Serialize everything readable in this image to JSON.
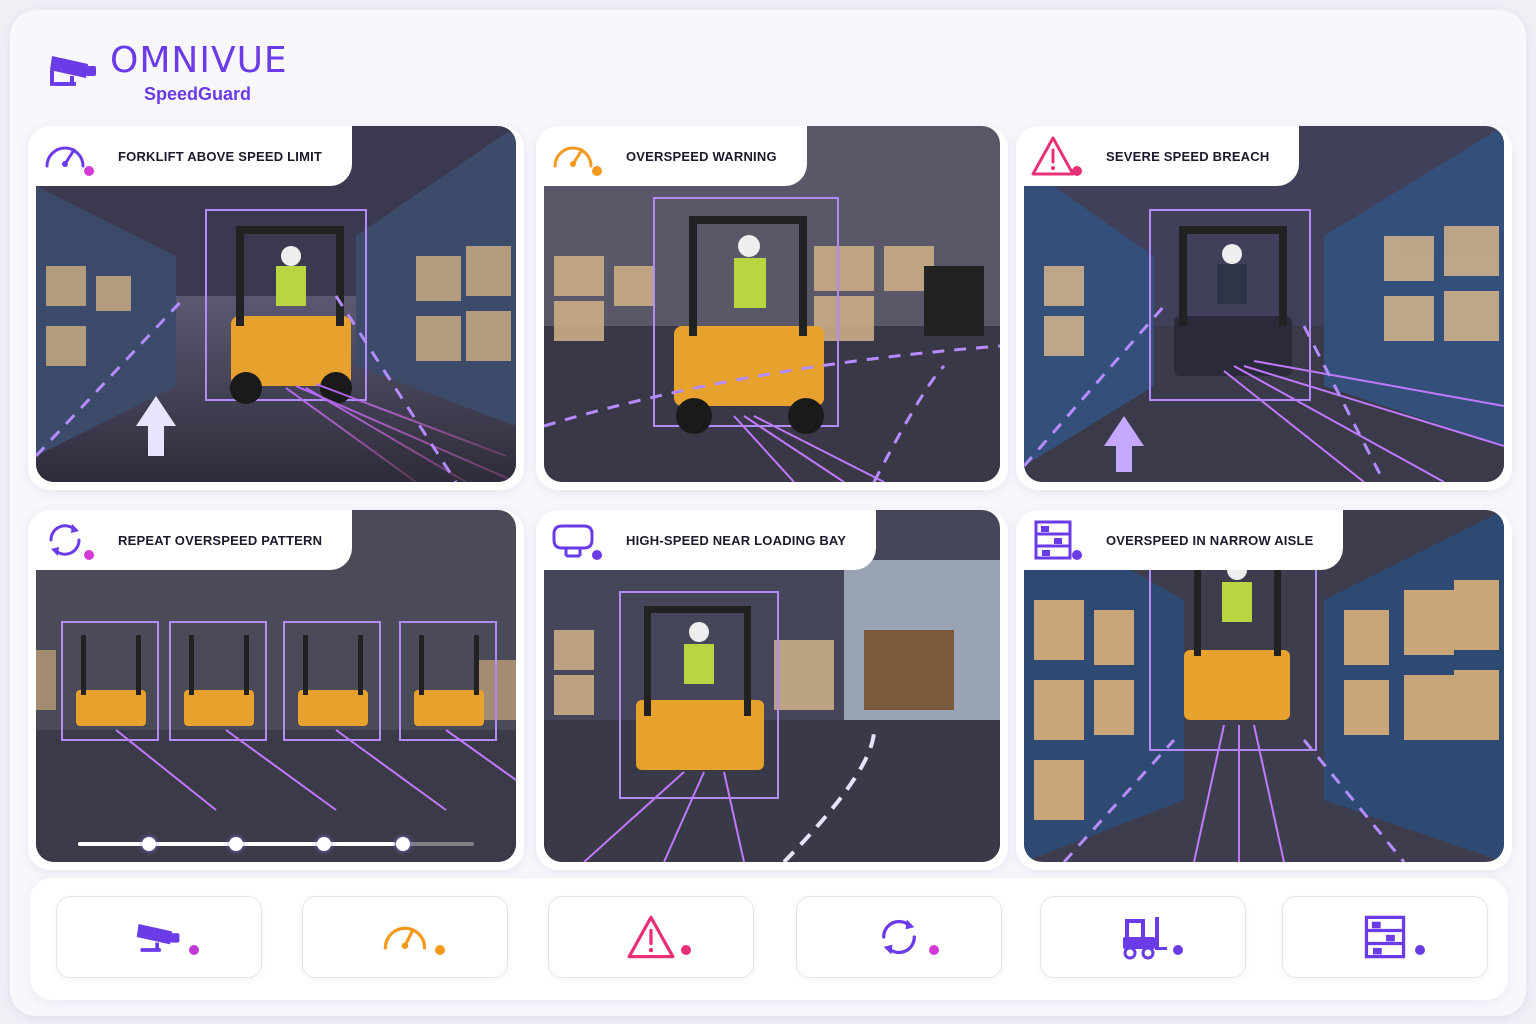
{
  "brand": {
    "name": "OMNIVUE",
    "product": "SpeedGuard",
    "logo_icon": "cctv-camera-icon"
  },
  "colors": {
    "purple": "#6a3be6",
    "orange": "#f39a1e",
    "pink": "#e8307a",
    "magenta": "#c13ad8",
    "dark_text": "#1c1a2c"
  },
  "events": [
    {
      "label": "FORKLIFT ABOVE SPEED LIMIT",
      "icon": "speedometer-icon",
      "icon_color": "#6a3be6",
      "dot_color": "#d43ad6"
    },
    {
      "label": "OVERSPEED WARNING",
      "icon": "speedometer-icon",
      "icon_color": "#f39a1e",
      "dot_color": "#f39a1e"
    },
    {
      "label": "SEVERE SPEED BREACH",
      "icon": "warning-triangle-icon",
      "icon_color": "#e8307a",
      "dot_color": "#e8307a"
    },
    {
      "label": "REPEAT OVERSPEED PATTERN",
      "icon": "refresh-cycle-icon",
      "icon_color": "#6a3be6",
      "dot_color": "#d43ad6"
    },
    {
      "label": "HIGH-SPEED NEAR LOADING BAY",
      "icon": "loading-bay-icon",
      "icon_color": "#6a3be6",
      "dot_color": "#6a3be6"
    },
    {
      "label": "OVERSPEED IN NARROW AISLE",
      "icon": "shelving-rack-icon",
      "icon_color": "#6a3be6",
      "dot_color": "#6a3be6"
    }
  ],
  "timeline": {
    "progress": 0.8,
    "markers": [
      0.18,
      0.4,
      0.62,
      0.82
    ]
  },
  "quick_actions": [
    {
      "icon": "cctv-camera-icon",
      "icon_color": "#6a3be6",
      "dot_color": "#c13ad8"
    },
    {
      "icon": "speedometer-icon",
      "icon_color": "#f39a1e",
      "dot_color": "#f39a1e"
    },
    {
      "icon": "warning-triangle-icon",
      "icon_color": "#e8307a",
      "dot_color": "#e8307a"
    },
    {
      "icon": "refresh-cycle-icon",
      "icon_color": "#6a3be6",
      "dot_color": "#d43ad6"
    },
    {
      "icon": "forklift-icon",
      "icon_color": "#6a3be6",
      "dot_color": "#6a3be6"
    },
    {
      "icon": "shelving-rack-icon",
      "icon_color": "#6a3be6",
      "dot_color": "#6a3be6"
    }
  ]
}
